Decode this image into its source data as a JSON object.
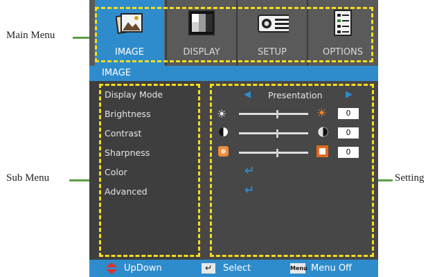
{
  "callouts": {
    "main_menu": "Main Menu",
    "sub_menu": "Sub Menu",
    "setting": "Setting"
  },
  "tabs": [
    {
      "label": "IMAGE",
      "icon": "image-icon",
      "active": true
    },
    {
      "label": "DISPLAY",
      "icon": "display-icon",
      "active": false
    },
    {
      "label": "SETUP",
      "icon": "setup-icon",
      "active": false
    },
    {
      "label": "OPTIONS",
      "icon": "options-icon",
      "active": false
    }
  ],
  "section_title": "IMAGE",
  "submenu": [
    "Display Mode",
    "Brightness",
    "Contrast",
    "Sharpness",
    "Color",
    "Advanced"
  ],
  "settings": {
    "display_mode": "Presentation",
    "brightness": {
      "value": "0",
      "level": 0.5
    },
    "contrast": {
      "value": "0",
      "level": 0.5
    },
    "sharpness": {
      "value": "0",
      "level": 0.5
    }
  },
  "bottom_bar": {
    "updown": "UpDown",
    "select": "Select",
    "menu_key": "Menu",
    "menu_off": "Menu Off"
  },
  "colors": {
    "accent_blue": "#2f8ccc",
    "highlight_yellow": "#f2de1e",
    "leader_green": "#5a9e43",
    "osd_gray": "#474747"
  }
}
